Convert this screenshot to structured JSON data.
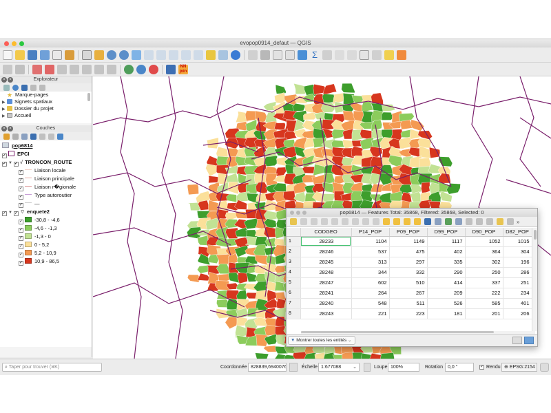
{
  "window": {
    "title": "evopop0914_defaut — QGIS"
  },
  "browser_panel": {
    "title": "Explorateur",
    "items": [
      {
        "label": "Marque-pages",
        "icon": "star-icon"
      },
      {
        "label": "Signets spatiaux",
        "icon": "spatial-bookmark-icon"
      },
      {
        "label": "Dossier du projet",
        "icon": "project-folder-icon"
      },
      {
        "label": "Accueil",
        "icon": "home-icon"
      }
    ]
  },
  "layers_panel": {
    "title": "Couches",
    "layers": [
      {
        "label": "pop6814"
      },
      {
        "label": "EPCI"
      },
      {
        "label": "TRONCON_ROUTE"
      },
      {
        "label": "Liaison locale",
        "color": "#f2cfc5"
      },
      {
        "label": "Liaison principale",
        "color": "#e8a8a0"
      },
      {
        "label": "Liaison r�gionale",
        "color": "#d98c8c"
      },
      {
        "label": "Type autoroutier",
        "color": "#c8a0d8"
      },
      {
        "label": "—",
        "color": "#cccccc"
      },
      {
        "label": "enquete2"
      },
      {
        "label": "-30,8 - -4,6",
        "color": "#3d9e2c"
      },
      {
        "label": "-4,6 - -1,3",
        "color": "#8ccc5c"
      },
      {
        "label": "-1,3 - 0",
        "color": "#c2e294"
      },
      {
        "label": "0 - 5,2",
        "color": "#fbe09a"
      },
      {
        "label": "5,2 - 10,9",
        "color": "#f49a52"
      },
      {
        "label": "10,9 - 86,5",
        "color": "#d7361e"
      }
    ]
  },
  "attribute_table": {
    "title": "pop6814 — Features Total: 35868, Filtered: 35868, Selected: 0",
    "columns": [
      "CODGEO",
      "P14_POP",
      "P09_POP",
      "D99_POP",
      "D90_POP",
      "D82_POP"
    ],
    "rows": [
      {
        "n": "1",
        "cells": [
          "28233",
          "1104",
          "1149",
          "1117",
          "1052",
          "1015"
        ]
      },
      {
        "n": "2",
        "cells": [
          "28246",
          "537",
          "475",
          "402",
          "364",
          "304"
        ]
      },
      {
        "n": "3",
        "cells": [
          "28245",
          "313",
          "297",
          "335",
          "302",
          "196"
        ]
      },
      {
        "n": "4",
        "cells": [
          "28248",
          "344",
          "332",
          "290",
          "250",
          "286"
        ]
      },
      {
        "n": "5",
        "cells": [
          "28247",
          "602",
          "510",
          "414",
          "337",
          "251"
        ]
      },
      {
        "n": "6",
        "cells": [
          "28241",
          "264",
          "267",
          "209",
          "222",
          "234"
        ]
      },
      {
        "n": "7",
        "cells": [
          "28240",
          "548",
          "511",
          "526",
          "585",
          "401"
        ]
      },
      {
        "n": "8",
        "cells": [
          "28243",
          "221",
          "223",
          "181",
          "201",
          "206"
        ]
      }
    ],
    "show_all_label": "Montrer toutes les entités"
  },
  "statusbar": {
    "search_placeholder": "Taper pour trouver (⌘K)",
    "coord_label": "Coordonnée",
    "coord_value": "828839,6940076",
    "scale_label": "Échelle",
    "scale_value": "1:677088",
    "magnifier_label": "Loupe",
    "magnifier_value": "100%",
    "rotation_label": "Rotation",
    "rotation_value": "0,0 °",
    "render_label": "Rendu",
    "crs_label": "EPSG:2154"
  },
  "colors": {
    "epci_boundary": "#7a1f6b",
    "map_classes": [
      "#3d9e2c",
      "#8ccc5c",
      "#c2e294",
      "#fbe09a",
      "#f49a52",
      "#d7361e"
    ]
  }
}
